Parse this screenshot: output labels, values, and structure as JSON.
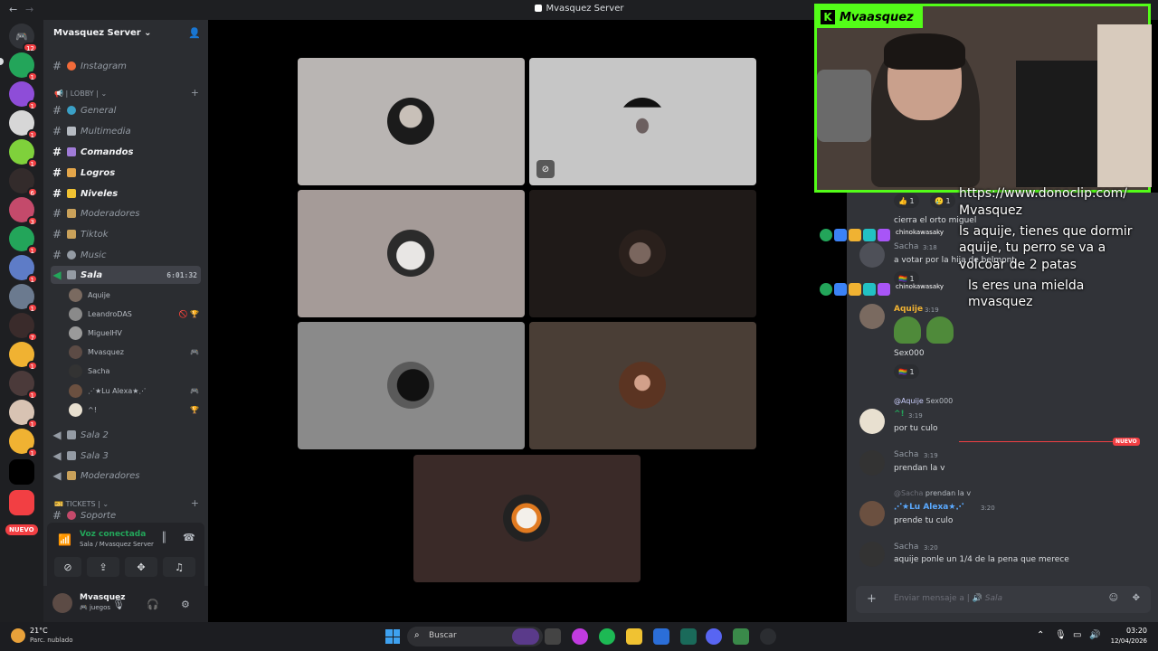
{
  "window": {
    "title": "Mvasquez Server",
    "back": "←",
    "forward": "→"
  },
  "server": {
    "name": "Mvasquez Server ⌄",
    "add_member_icon": "add-member-icon"
  },
  "rail": {
    "badges": [
      "12",
      "1",
      "1",
      "1",
      "1",
      "6",
      "3",
      "1",
      "1",
      "1",
      "7",
      "1",
      "1",
      "1",
      "1"
    ],
    "nuevo": "NUEVO"
  },
  "sidebar": {
    "top_channel": "Instagram",
    "lobby_category": "LOBBY",
    "channels": [
      "General",
      "Multimedia",
      "Comandos",
      "Logros",
      "Niveles",
      "Moderadores",
      "Tiktok",
      "Music"
    ],
    "active_voice": {
      "name": "Sala",
      "timer": "6:01:32"
    },
    "voice_users": [
      "Aquije",
      "LeandroDAS",
      "MiguelHV",
      "Mvasquez",
      "Sacha",
      "⋰★Lu Alexa★⋰",
      "^!"
    ],
    "other_voice": [
      "Sala 2",
      "Sala 3",
      "Moderadores"
    ],
    "tickets_category": "TICKETS",
    "bottom_channel": "Soporte"
  },
  "voice_panel": {
    "status": "Voz conectada",
    "location": "Sala / Mvasquez Server"
  },
  "user_panel": {
    "name": "Mvasquez",
    "status": "juegos"
  },
  "cam": {
    "tag": "Mvaasquez",
    "logo": "K"
  },
  "chat": {
    "overlay": {
      "line1": "https://www.donoclip.com/",
      "line2": "Mvasquez",
      "line3": "ls aquije, tienes que dormir",
      "line4": "aquije, tu perro se va a",
      "line5": "volcoar de 2 patas",
      "line6": "ls eres una mielda",
      "line7": "mvasquez",
      "user": "chinokawasaky"
    },
    "reactions_top": {
      "thumbs": "👍 1",
      "face": "🥲 1"
    },
    "msg_cierra": "cierra el  orto miguel",
    "sacha_1": {
      "author": "Sacha",
      "time": "3:18",
      "text": "a votar por la hija de belmont"
    },
    "react_flag": "🏳️‍🌈 1",
    "aquije": {
      "author": "Aquije",
      "time": "3:19",
      "text": "Sex000"
    },
    "react_flag2": "🏳️‍🌈 1",
    "reply": {
      "mention": "@Aquije",
      "quote": "Sex000",
      "author": "^!",
      "time": "3:19",
      "text": "por tu culo"
    },
    "new_tag": "NUEVO",
    "sacha_2": {
      "author": "Sacha",
      "time": "3:19",
      "text": "prendan la v"
    },
    "reply2": {
      "mention": "@Sacha",
      "quote": "prendan la v",
      "author": "⋰★Lu Alexa★⋰",
      "time": "3:20",
      "text": "prende tu culo"
    },
    "sacha_3": {
      "author": "Sacha",
      "time": "3:20",
      "text": "aquije ponle un 1/4 de la pena que merece"
    },
    "input_placeholder": "Enviar mensaje a",
    "input_channel": "Sala"
  },
  "taskbar": {
    "temp": "21°C",
    "weather": "Parc. nublado",
    "search": "Buscar",
    "time": "03:20",
    "date": "12/04/2026"
  },
  "colors": {
    "kick_green": "#53fc18",
    "discord_blurple": "#5865f2",
    "online_green": "#23a55a",
    "danger_red": "#f23f43"
  }
}
